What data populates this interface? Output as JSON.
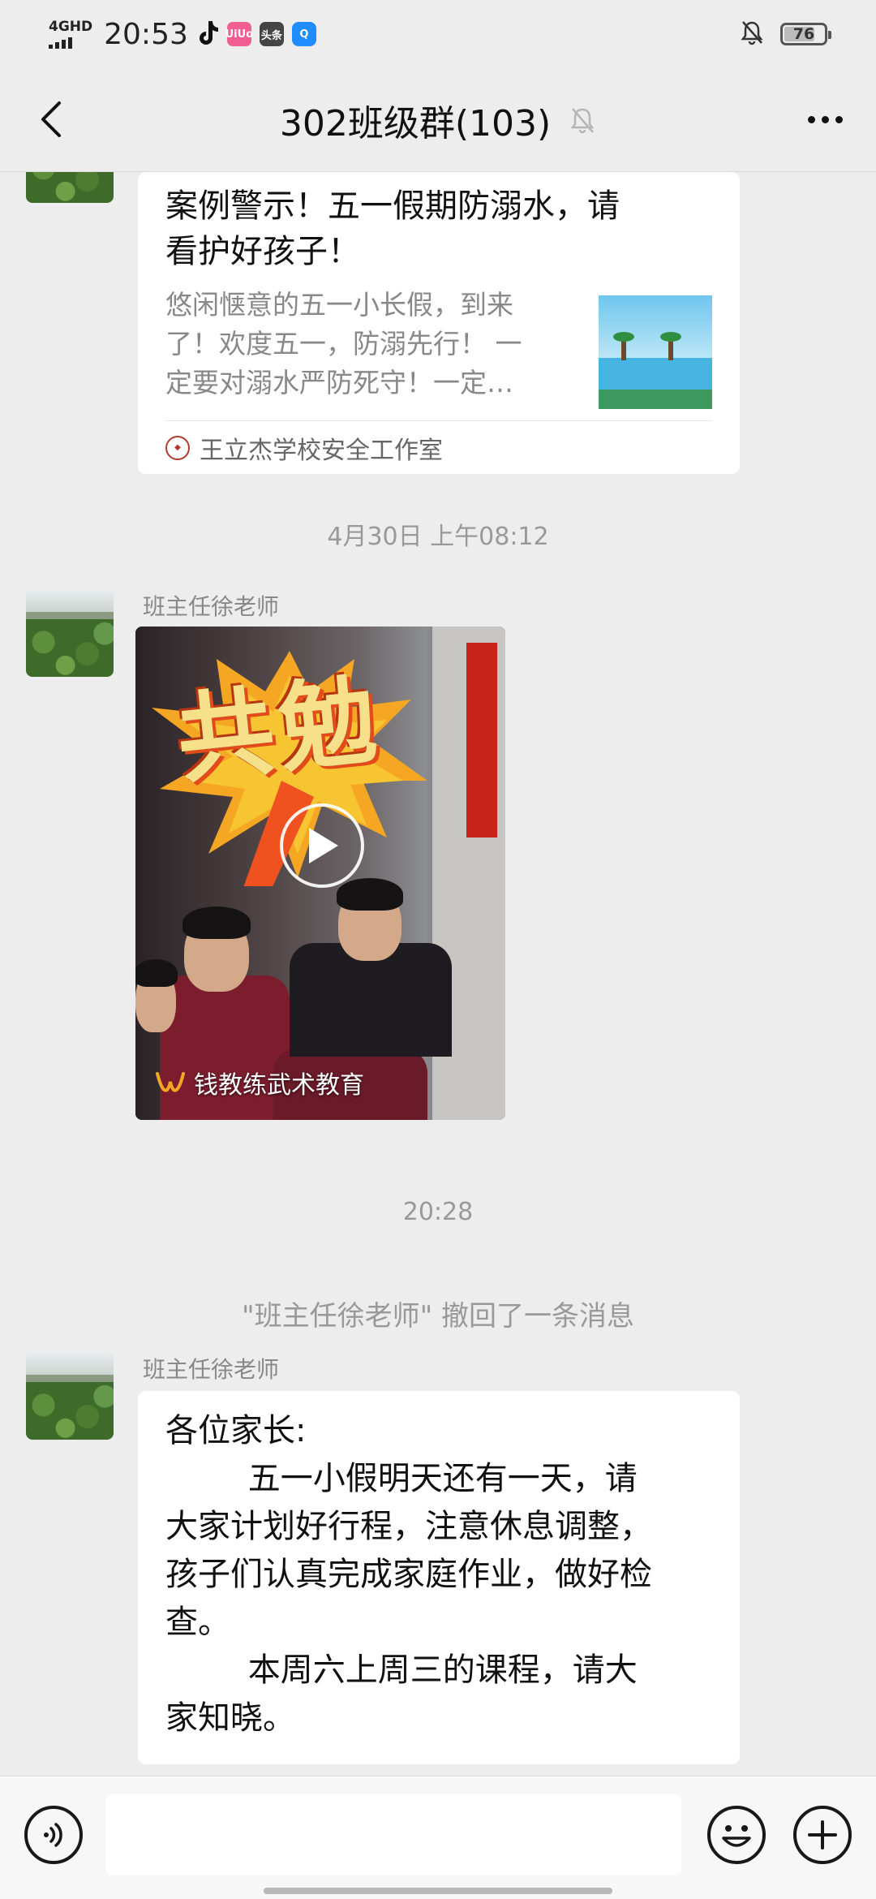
{
  "status_bar": {
    "network": "4GHD",
    "time": "20:53",
    "apps": [
      {
        "icon": "tiktok-icon",
        "label": "",
        "color": "#111111"
      },
      {
        "icon": "app-badge-icon",
        "label": "UiUo",
        "color": "#f25e92"
      },
      {
        "icon": "toutiao-icon",
        "label": "头条",
        "color": "#444444"
      },
      {
        "icon": "app-q-icon",
        "label": "Q",
        "color": "#1f8cff"
      }
    ],
    "battery": "76"
  },
  "nav": {
    "title": "302班级群(103)",
    "muted": true
  },
  "messages": {
    "article": {
      "title_line1": "案例警示！五一假期防溺水，请",
      "title_line2": "看护好孩子！",
      "desc_line1": "悠闲惬意的五一小长假，到来",
      "desc_line2": "了！欢度五一，防溺先行！ 一",
      "desc_line3": "定要对溺水严防死守！一定…",
      "source": "王立杰学校安全工作室"
    },
    "time_1": "4月30日 上午08:12",
    "video_msg": {
      "sender": "班主任徐老师",
      "caption": "共勉",
      "source": "钱教练武术教育"
    },
    "time_2": "20:28",
    "recall_notice": "\"班主任徐老师\" 撤回了一条消息",
    "text_msg": {
      "sender": "班主任徐老师",
      "lines": [
        "各位家长:",
        "        五一小假明天还有一天，请",
        "大家计划好行程，注意休息调整，",
        "孩子们认真完成家庭作业，做好检",
        "查。",
        "        本周六上周三的课程，请大",
        "家知晓。"
      ]
    }
  },
  "input_bar": {
    "placeholder": ""
  },
  "colors": {
    "background": "#ededed",
    "bubble": "#ffffff",
    "muted_text": "#999999"
  }
}
